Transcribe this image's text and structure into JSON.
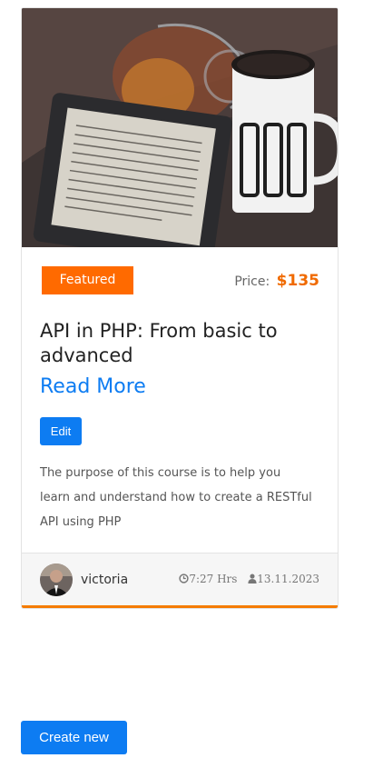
{
  "course_card": {
    "badge": "Featured",
    "price_label": "Price:",
    "price_value": "$135",
    "title": "API in PHP: From basic to advanced",
    "read_more": "Read More",
    "edit_label": "Edit",
    "description": "The purpose of this course is to help you learn and understand how to create a RESTful API using PHP",
    "author": "victoria",
    "duration": "7:27 Hrs",
    "date": "13.11.2023",
    "image_icon": "photo-ereader-and-coffee-mug"
  },
  "actions": {
    "create_label": "Create new"
  },
  "colors": {
    "accent_orange": "#ff6a00",
    "primary_blue": "#0d7cf2",
    "footer_bg": "#f6f6f6"
  }
}
